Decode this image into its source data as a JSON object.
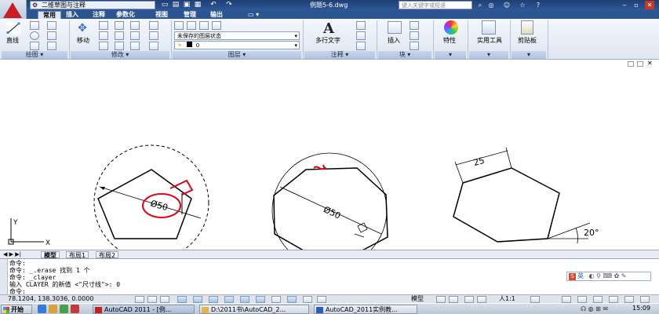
{
  "title_bar": {
    "workspace": "二维草图与注释",
    "document_title": "例题5-6.dwg",
    "search_placeholder": "键入关键字或短语"
  },
  "tabs": [
    "常用",
    "插入",
    "注释",
    "参数化",
    "视图",
    "管理",
    "输出"
  ],
  "active_tab": "常用",
  "ribbon": {
    "draw_line": "直线",
    "modify_move": "移动",
    "layer_state": "未保存的图层状态",
    "layer_current": "0",
    "multiline_text": "多行文字",
    "insert": "插入",
    "properties": "特性",
    "utilities": "实用工具",
    "clipboard": "剪贴板",
    "panels": [
      "绘图",
      "修改",
      "图层",
      "注释",
      "块"
    ]
  },
  "drawing": {
    "pentagon_dim": "Ø50",
    "octagon_dim": "Ø50",
    "hexagon_side": "25",
    "hexagon_angle": "20°",
    "ucs_y": "Y",
    "ucs_x": "X"
  },
  "layout_tabs": [
    "模型",
    "布局1",
    "布局2"
  ],
  "command_history": [
    "命令:",
    "命令: _.erase 找到 1 个",
    "命令: _clayer",
    "输入 CLAYER 的新值 <\"尺寸线\">: 0",
    "命令:"
  ],
  "status": {
    "coords": "78.1204, 138.3036, 0.0000",
    "model": "模型",
    "scale": "人1:1",
    "time": "15:09"
  },
  "ime": {
    "label": "英"
  },
  "taskbar": {
    "start": "开始",
    "items": [
      "AutoCAD 2011 - [例...",
      "D:\\2011书\\AutoCAD_2...",
      "AutoCAD_2011实例教..."
    ]
  },
  "colors": {
    "title_blue": "#1f3f74",
    "ribbon_bg": "#e4ebf5",
    "accent_red": "#e0001a"
  }
}
